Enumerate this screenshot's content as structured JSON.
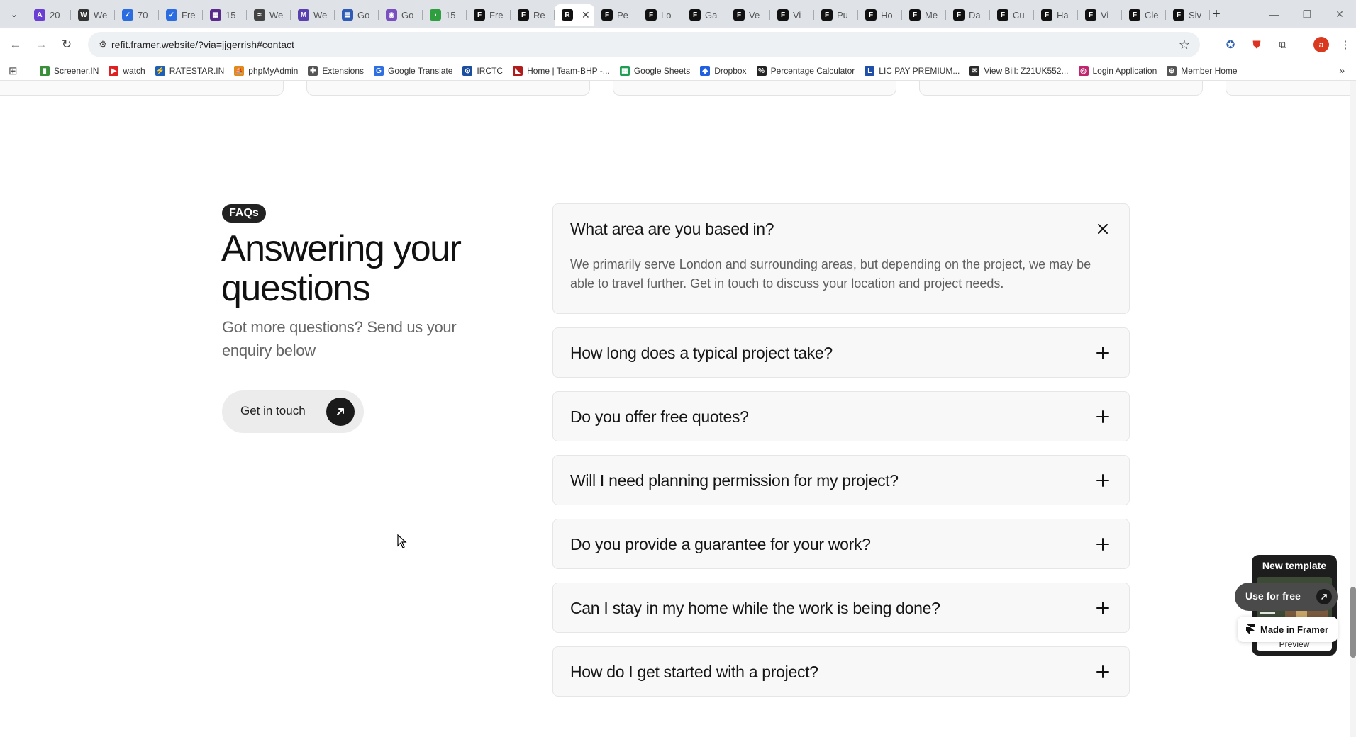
{
  "browser": {
    "tabs": [
      {
        "title": "20",
        "color": "#6b3fd4",
        "glyph": "A"
      },
      {
        "title": "We",
        "color": "#333333",
        "glyph": "W"
      },
      {
        "title": "70",
        "color": "#2b6de0",
        "glyph": "✓"
      },
      {
        "title": "Fre",
        "color": "#2b6de0",
        "glyph": "✓"
      },
      {
        "title": "15",
        "color": "#5a2a8a",
        "glyph": "▦"
      },
      {
        "title": "We",
        "color": "#444444",
        "glyph": "≈"
      },
      {
        "title": "We",
        "color": "#5a3fb0",
        "glyph": "M"
      },
      {
        "title": "Go",
        "color": "#2d5bb5",
        "glyph": "▤"
      },
      {
        "title": "Go",
        "color": "#7a4fc0",
        "glyph": "◉"
      },
      {
        "title": "15",
        "color": "#2f9e3f",
        "glyph": "◗"
      },
      {
        "title": "Fre",
        "color": "#111111",
        "glyph": "F"
      },
      {
        "title": "Re",
        "color": "#111111",
        "glyph": "F"
      },
      {
        "title": "",
        "color": "#111111",
        "glyph": "R",
        "active": true
      },
      {
        "title": "Pe",
        "color": "#111111",
        "glyph": "F"
      },
      {
        "title": "Lo",
        "color": "#111111",
        "glyph": "F"
      },
      {
        "title": "Ga",
        "color": "#111111",
        "glyph": "F"
      },
      {
        "title": "Ve",
        "color": "#111111",
        "glyph": "F"
      },
      {
        "title": "Vi",
        "color": "#111111",
        "glyph": "F"
      },
      {
        "title": "Pu",
        "color": "#111111",
        "glyph": "F"
      },
      {
        "title": "Ho",
        "color": "#111111",
        "glyph": "F"
      },
      {
        "title": "Me",
        "color": "#111111",
        "glyph": "F"
      },
      {
        "title": "Da",
        "color": "#111111",
        "glyph": "F"
      },
      {
        "title": "Cu",
        "color": "#111111",
        "glyph": "F"
      },
      {
        "title": "Ha",
        "color": "#111111",
        "glyph": "F"
      },
      {
        "title": "Vi",
        "color": "#111111",
        "glyph": "F"
      },
      {
        "title": "Cle",
        "color": "#111111",
        "glyph": "F"
      },
      {
        "title": "Siv",
        "color": "#111111",
        "glyph": "F"
      }
    ],
    "url": "refit.framer.website/?via=jjgerrish#contact",
    "profile_initial": "a",
    "bookmarks": [
      {
        "label": "Screener.IN",
        "color": "#3a8f3a",
        "glyph": "▮"
      },
      {
        "label": "watch",
        "color": "#e02020",
        "glyph": "▶"
      },
      {
        "label": "RATESTAR.IN",
        "color": "#1b5fb8",
        "glyph": "⚡"
      },
      {
        "label": "phpMyAdmin",
        "color": "#e08a1a",
        "glyph": "⛵"
      },
      {
        "label": "Extensions",
        "color": "#555555",
        "glyph": "✚"
      },
      {
        "label": "Google Translate",
        "color": "#2f6fe0",
        "glyph": "G"
      },
      {
        "label": "IRCTC",
        "color": "#1b4f9e",
        "glyph": "⊙"
      },
      {
        "label": "Home | Team-BHP -...",
        "color": "#b01c1c",
        "glyph": "◣"
      },
      {
        "label": "Google Sheets",
        "color": "#1f9d55",
        "glyph": "▦"
      },
      {
        "label": "Dropbox",
        "color": "#1f5fe0",
        "glyph": "◆"
      },
      {
        "label": "Percentage Calculator",
        "color": "#222222",
        "glyph": "%"
      },
      {
        "label": "LIC PAY PREMIUM...",
        "color": "#1f4fa8",
        "glyph": "L"
      },
      {
        "label": "View Bill: Z21UK552...",
        "color": "#2a2a2a",
        "glyph": "✉"
      },
      {
        "label": "Login Application",
        "color": "#c0266d",
        "glyph": "◎"
      },
      {
        "label": "Member Home",
        "color": "#555555",
        "glyph": "⊕"
      }
    ]
  },
  "faq": {
    "badge": "FAQs",
    "title": "Answering your questions",
    "subtitle": "Got more questions? Send us your enquiry below",
    "cta_label": "Get in touch",
    "items": [
      {
        "question": "What area are you based in?",
        "answer": "We primarily serve London and surrounding areas, but depending on the project, we may be able to travel further. Get in touch to discuss your location and project needs.",
        "open": true
      },
      {
        "question": "How long does a typical project take?",
        "open": false
      },
      {
        "question": "Do you offer free quotes?",
        "open": false
      },
      {
        "question": "Will I need planning permission for my project?",
        "open": false
      },
      {
        "question": "Do you provide a guarantee for your work?",
        "open": false
      },
      {
        "question": "Can I stay in my home while the work is being done?",
        "open": false
      },
      {
        "question": "How do I get started with a project?",
        "open": false
      }
    ]
  },
  "framer_widget": {
    "template_title": "New template",
    "preview_label": "Preview",
    "use_free_label": "Use for free",
    "made_in_label": "Made in Framer"
  }
}
